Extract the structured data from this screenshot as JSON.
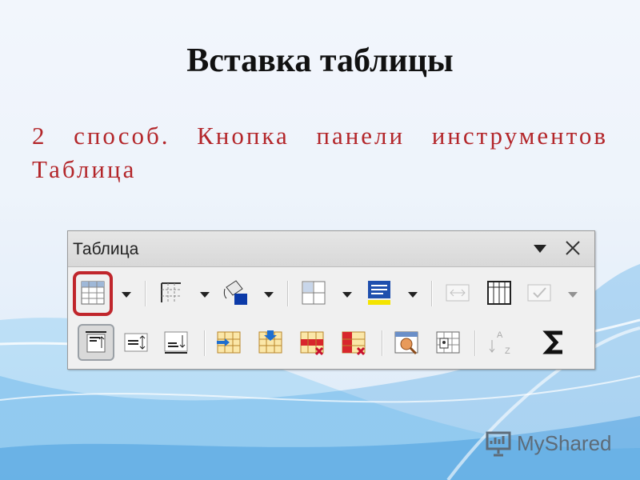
{
  "slide": {
    "title": "Вставка таблицы",
    "subtitle_line1": "2 способ. Кнопка панели инструментов",
    "subtitle_line2": "Таблица"
  },
  "toolbar": {
    "title": "Таблица",
    "menu_icon": "triangle-down-icon",
    "close_icon": "close-icon",
    "row1": [
      {
        "name": "insert-table",
        "icon": "table-grid-icon",
        "dropdown": true,
        "highlighted": true
      },
      {
        "name": "borders",
        "icon": "borders-icon",
        "dropdown": true
      },
      {
        "name": "border-style",
        "icon": "border-color-icon",
        "dropdown": true
      },
      {
        "name": "table-properties",
        "icon": "cell-split-icon",
        "dropdown": true
      },
      {
        "name": "background-color",
        "icon": "fill-color-icon",
        "dropdown": true
      },
      {
        "name": "merge-cells",
        "icon": "merge-cells-icon",
        "disabled": true
      },
      {
        "name": "split-cells",
        "icon": "split-cells-icon"
      },
      {
        "name": "autofit",
        "icon": "autofit-icon",
        "dropdown": true,
        "disabled": true
      }
    ],
    "row2": [
      {
        "name": "align-top",
        "icon": "align-top-icon",
        "pressed": true
      },
      {
        "name": "center-vertically",
        "icon": "align-middle-icon"
      },
      {
        "name": "align-bottom",
        "icon": "align-bottom-icon"
      },
      {
        "name": "insert-row",
        "icon": "insert-row-icon"
      },
      {
        "name": "insert-column",
        "icon": "insert-column-icon"
      },
      {
        "name": "delete-row",
        "icon": "delete-row-icon"
      },
      {
        "name": "delete-column",
        "icon": "delete-column-icon"
      },
      {
        "name": "autoformat",
        "icon": "autoformat-icon"
      },
      {
        "name": "table-properties-2",
        "icon": "table-properties-icon"
      },
      {
        "name": "sort",
        "icon": "sort-az-icon",
        "disabled": true
      },
      {
        "name": "sum",
        "icon": "sum-icon"
      }
    ]
  },
  "watermark": {
    "text": "MyShared"
  },
  "colors": {
    "title": "#111111",
    "subtitle": "#b3262a",
    "highlight": "#c0262c"
  }
}
